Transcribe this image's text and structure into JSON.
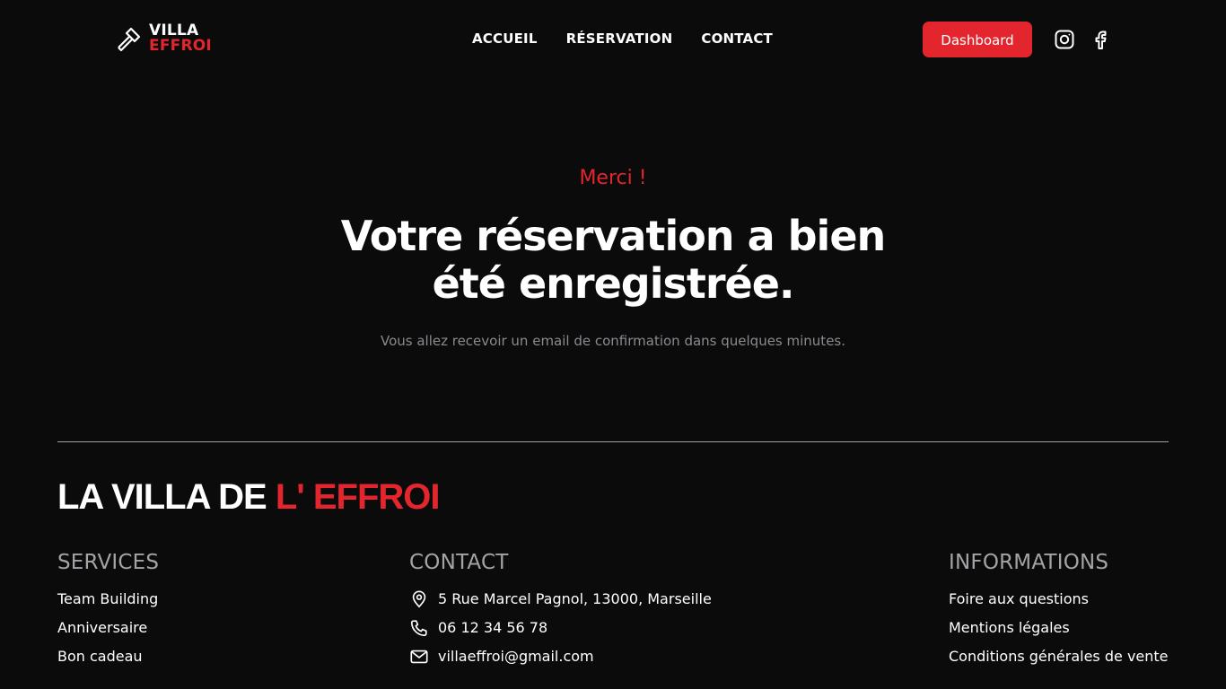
{
  "nav": {
    "logo_line1": "VILLA",
    "logo_line2": "EFFROI",
    "links": [
      "ACCUEIL",
      "RÉSERVATION",
      "CONTACT"
    ],
    "dashboard_label": "Dashboard"
  },
  "hero": {
    "kicker": "Merci !",
    "headline": "Votre réservation a bien été enregistrée.",
    "subtext": "Vous allez recevoir un email de confirmation dans quelques minutes."
  },
  "footer": {
    "title_part1": "LA VILLA DE ",
    "title_part2": "L' EFFROI",
    "services": {
      "heading": "SERVICES",
      "items": [
        "Team Building",
        "Anniversaire",
        "Bon cadeau"
      ]
    },
    "contact": {
      "heading": "CONTACT",
      "address": "5 Rue Marcel Pagnol, 13000, Marseille",
      "phone": "06 12 34 56 78",
      "email": "villaeffroi@gmail.com"
    },
    "informations": {
      "heading": "INFORMATIONS",
      "items": [
        "Foire aux questions",
        "Mentions légales",
        "Conditions générales de vente"
      ]
    }
  },
  "colors": {
    "background": "#0b0b0c",
    "accent": "#e3262d",
    "muted": "#8a8a90"
  },
  "icons": [
    "axe-icon",
    "instagram-icon",
    "facebook-icon",
    "location-pin-icon",
    "phone-icon",
    "mail-icon"
  ]
}
